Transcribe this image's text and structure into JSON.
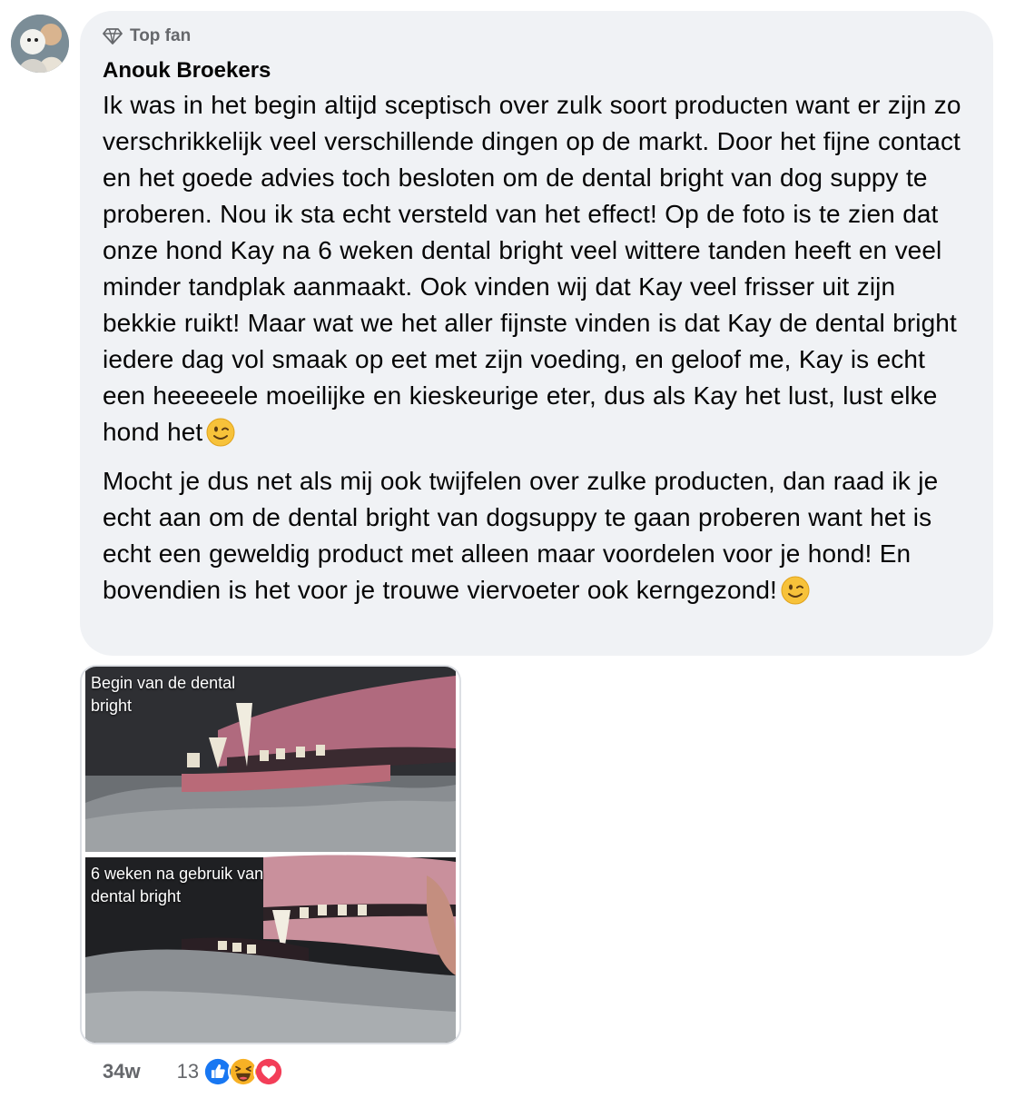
{
  "comment": {
    "author_badge": "Top fan",
    "badge_icon": "diamond-icon",
    "author_name": "Anouk Broekers",
    "paragraph1": "Ik was in het begin altijd sceptisch over zulk soort producten want er zijn zo verschrikkelijk veel verschillende dingen op de markt. Door het fijne contact en het goede advies toch besloten om de dental bright van dog suppy te proberen. Nou ik sta echt versteld van het effect! Op de foto is te zien dat onze hond Kay na 6 weken dental bright veel wittere tanden heeft en veel minder tandplak aanmaakt. Ook vinden wij dat Kay veel frisser uit zijn bekkie ruikt! Maar wat we het aller fijnste vinden is dat Kay de dental bright iedere dag vol smaak op eet met zijn voeding, en geloof me, Kay is echt een heeeeele moeilijke en kieskeurige eter, dus als Kay het lust, lust elke hond het",
    "paragraph2": "Mocht je dus net als mij ook twijfelen over zulke producten, dan raad ik je echt aan om de dental bright van dogsuppy te gaan proberen want het is echt een geweldig product met alleen maar voordelen voor je hond! En bovendien is het voor je trouwe viervoeter ook kerngezond!",
    "emoji": "wink-emoji"
  },
  "photo": {
    "caption_top_line1": "Begin van de dental",
    "caption_top_line2": "bright",
    "caption_bottom_line1": "6 weken na gebruik van",
    "caption_bottom_line2": "dental bright"
  },
  "footer": {
    "timestamp": "34w",
    "reaction_count": "13",
    "reactions": [
      "like-icon",
      "haha-icon",
      "love-icon"
    ]
  },
  "colors": {
    "bubble_bg": "#f0f2f5",
    "secondary_text": "#65676b",
    "like_blue": "#1877f2",
    "love_red": "#f33e58",
    "haha_yellow": "#f7b125"
  }
}
